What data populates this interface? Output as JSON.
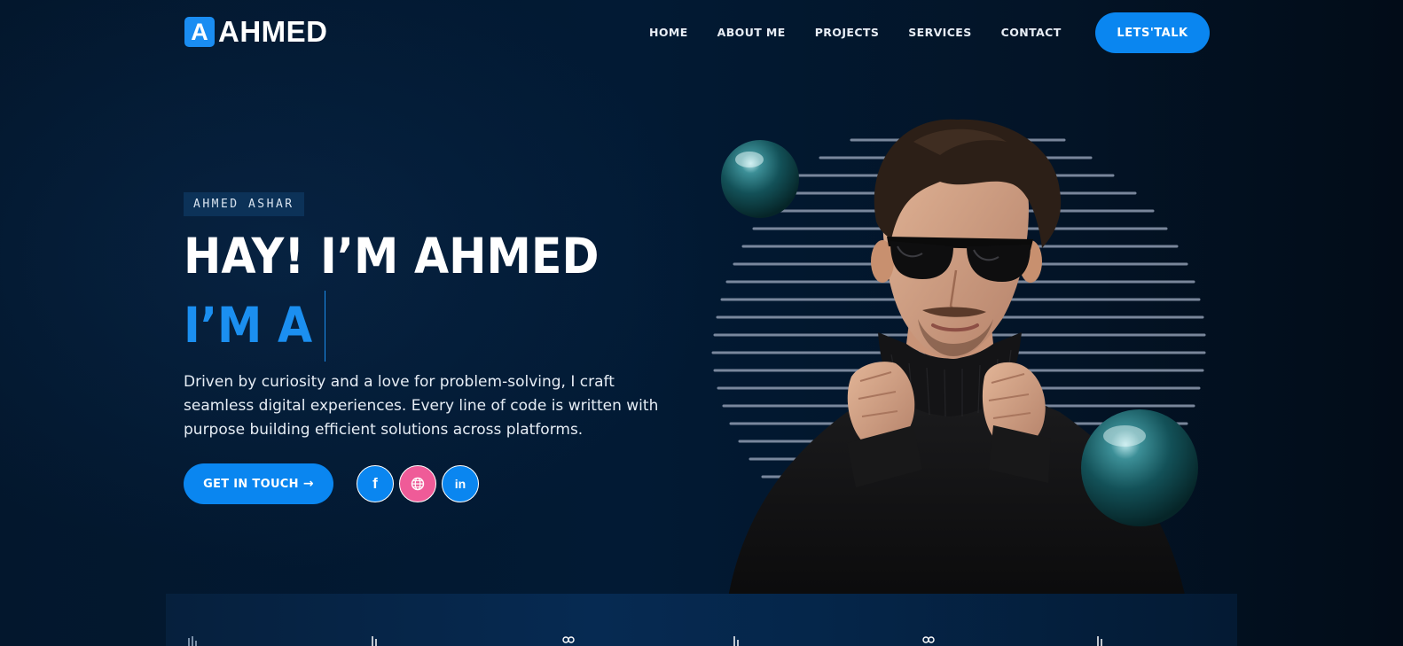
{
  "brand": {
    "logo_letter": "A",
    "name": "AHMED"
  },
  "nav": {
    "items": [
      {
        "label": "HOME"
      },
      {
        "label": "ABOUT ME"
      },
      {
        "label": "PROJECTS"
      },
      {
        "label": "SERVICES"
      },
      {
        "label": "CONTACT"
      }
    ],
    "cta_label": "LETS'TALK"
  },
  "hero": {
    "tag": "AHMED ASHAR",
    "title": "HAY! I’M AHMED",
    "typing_prefix": "I’M A",
    "description_lines": [
      "Driven by curiosity and a love for problem-solving, I craft",
      "seamless digital experiences. Every line of code is written with",
      "purpose building efficient solutions across platforms."
    ],
    "cta_label": "GET IN TOUCH",
    "cta_icon": "arrow-right-icon",
    "socials": [
      {
        "icon": "facebook-icon",
        "glyph": "f",
        "color": "#0a86f0"
      },
      {
        "icon": "globe-icon",
        "glyph": "",
        "color": "#ef5b98"
      },
      {
        "icon": "linkedin-icon",
        "glyph": "in",
        "color": "#0a86f0"
      }
    ]
  },
  "colors": {
    "accent": "#0a86f0",
    "accent_text": "#1b8ff0",
    "pink": "#ef5b98",
    "background": "#031428",
    "tag_bg": "#0c3258"
  }
}
